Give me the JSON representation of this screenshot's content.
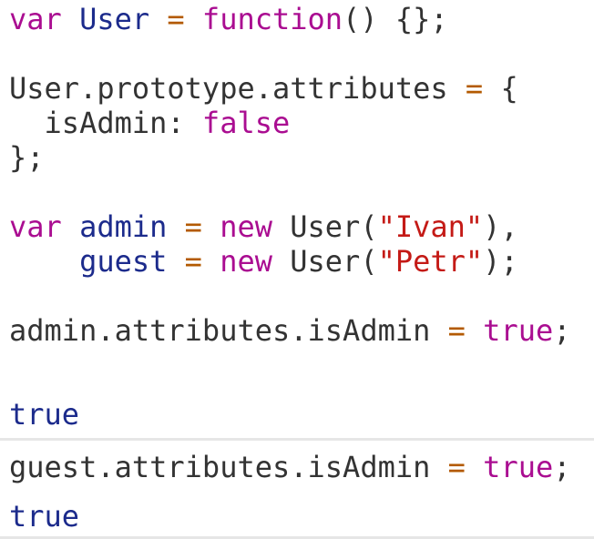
{
  "console": {
    "input_1": {
      "lines": [
        [
          {
            "t": "var",
            "c": "kw"
          },
          {
            "t": " ",
            "c": "plain"
          },
          {
            "t": "User",
            "c": "var"
          },
          {
            "t": " ",
            "c": "plain"
          },
          {
            "t": "=",
            "c": "op"
          },
          {
            "t": " ",
            "c": "plain"
          },
          {
            "t": "function",
            "c": "kw"
          },
          {
            "t": "() {};",
            "c": "plain"
          }
        ],
        [],
        [
          {
            "t": "User.prototype.attributes ",
            "c": "plain"
          },
          {
            "t": "=",
            "c": "op"
          },
          {
            "t": " {",
            "c": "plain"
          }
        ],
        [
          {
            "t": "  isAdmin: ",
            "c": "plain"
          },
          {
            "t": "false",
            "c": "kw"
          }
        ],
        [
          {
            "t": "};",
            "c": "plain"
          }
        ],
        [],
        [
          {
            "t": "var",
            "c": "kw"
          },
          {
            "t": " ",
            "c": "plain"
          },
          {
            "t": "admin",
            "c": "var"
          },
          {
            "t": " ",
            "c": "plain"
          },
          {
            "t": "=",
            "c": "op"
          },
          {
            "t": " ",
            "c": "plain"
          },
          {
            "t": "new",
            "c": "kw"
          },
          {
            "t": " User(",
            "c": "plain"
          },
          {
            "t": "\"Ivan\"",
            "c": "str"
          },
          {
            "t": "),",
            "c": "plain"
          }
        ],
        [
          {
            "t": "    ",
            "c": "plain"
          },
          {
            "t": "guest",
            "c": "var"
          },
          {
            "t": " ",
            "c": "plain"
          },
          {
            "t": "=",
            "c": "op"
          },
          {
            "t": " ",
            "c": "plain"
          },
          {
            "t": "new",
            "c": "kw"
          },
          {
            "t": " User(",
            "c": "plain"
          },
          {
            "t": "\"Petr\"",
            "c": "str"
          },
          {
            "t": ");",
            "c": "plain"
          }
        ],
        [],
        [
          {
            "t": "admin.attributes.isAdmin ",
            "c": "plain"
          },
          {
            "t": "=",
            "c": "op"
          },
          {
            "t": " ",
            "c": "plain"
          },
          {
            "t": "true",
            "c": "kw"
          },
          {
            "t": ";",
            "c": "plain"
          }
        ]
      ]
    },
    "result_1": "true",
    "input_2": {
      "lines": [
        [
          {
            "t": "guest.attributes.isAdmin ",
            "c": "plain"
          },
          {
            "t": "=",
            "c": "op"
          },
          {
            "t": " ",
            "c": "plain"
          },
          {
            "t": "true",
            "c": "kw"
          },
          {
            "t": ";",
            "c": "plain"
          }
        ]
      ]
    },
    "result_2": "true"
  },
  "colors": {
    "keyword": "#aa0d91",
    "variable": "#1c2b8c",
    "string": "#c41a16",
    "operator": "#b35a00",
    "plain": "#333333",
    "divider": "#e6e6e6"
  }
}
